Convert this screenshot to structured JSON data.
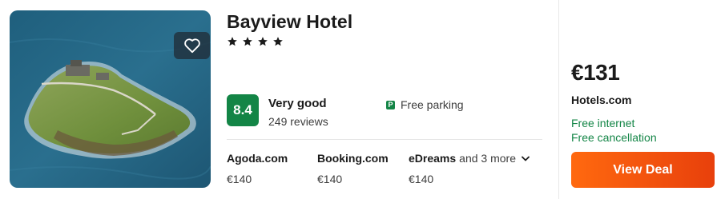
{
  "hotel": {
    "name": "Bayview Hotel",
    "star_count": 4,
    "star_icon": "star-icon",
    "favorite_icon": "heart-icon",
    "image_alt": "aerial-photo-island-headland"
  },
  "rating": {
    "score": "8.4",
    "word": "Very good",
    "reviews": "249 reviews",
    "badge_color": "#138546"
  },
  "amenity": {
    "icon": "parking-icon",
    "icon_glyph": "P",
    "label": "Free parking"
  },
  "providers": [
    {
      "name": "Agoda.com",
      "price": "€140"
    },
    {
      "name": "Booking.com",
      "price": "€140"
    },
    {
      "name": "eDreams",
      "more": "and 3 more",
      "price": "€140",
      "chevron_icon": "chevron-down-icon"
    }
  ],
  "deal": {
    "price": "€131",
    "provider": "Hotels.com",
    "perks": [
      "Free internet",
      "Free cancellation"
    ],
    "button_label": "View Deal",
    "accent_color": "#ff690f",
    "perk_color": "#138546"
  }
}
